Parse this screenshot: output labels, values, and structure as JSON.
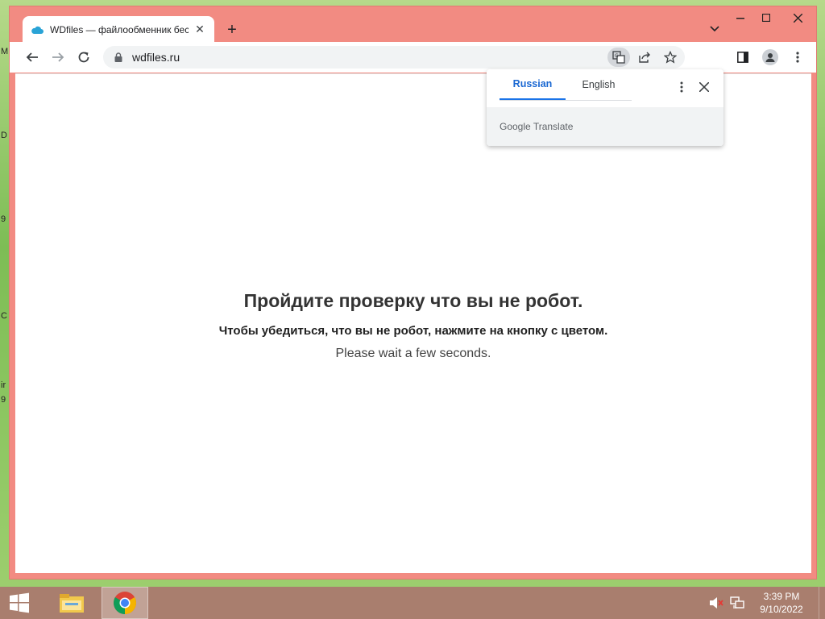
{
  "browser": {
    "tab_title": "WDfiles — файлообменник бес",
    "url": "wdfiles.ru"
  },
  "translate": {
    "tab_source": "Russian",
    "tab_target": "English",
    "footer_brand": "Google Translate"
  },
  "page": {
    "title": "Пройдите проверку что вы не робот.",
    "subtitle": "Чтобы убедиться, что вы не робот, нажмите на кнопку с цветом.",
    "wait_text": "Please wait a few seconds."
  },
  "taskbar": {
    "time": "3:39 PM",
    "date": "9/10/2022"
  },
  "desktop": {
    "edge_glyphs": [
      "M",
      "D",
      "9",
      "C",
      "ir",
      "9"
    ]
  },
  "colors": {
    "window_frame": "#f28b82",
    "accent": "#1a73e8"
  }
}
